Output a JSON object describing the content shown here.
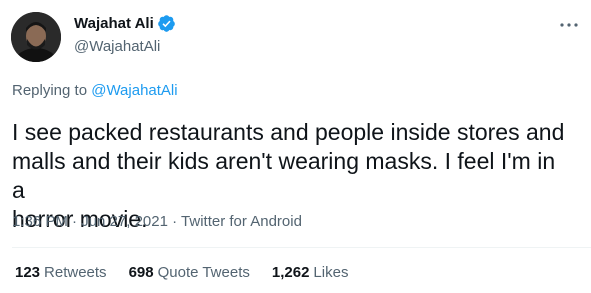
{
  "author": {
    "display_name": "Wajahat Ali",
    "handle": "@WajahatAli",
    "avatar_icon": "avatar-photo",
    "verified_icon": "verified-badge-icon"
  },
  "reply": {
    "prefix": "Replying to",
    "mention": "@WajahatAli"
  },
  "tweet": {
    "text": "I see packed restaurants and people inside stores and\nmalls and their kids aren't wearing masks. I feel I'm in a\nhorror movie."
  },
  "meta": {
    "time": "1:36 PM",
    "sep1": " · ",
    "date": "Jun 27, 2021",
    "sep2": " · ",
    "source": "Twitter for Android"
  },
  "stats": {
    "retweets": {
      "count": "123",
      "label": "Retweets"
    },
    "quotes": {
      "count": "698",
      "label": "Quote Tweets"
    },
    "likes": {
      "count": "1,262",
      "label": "Likes"
    }
  },
  "colors": {
    "text": "#0f1419",
    "secondary": "#536471",
    "accent": "#1d9bf0"
  }
}
